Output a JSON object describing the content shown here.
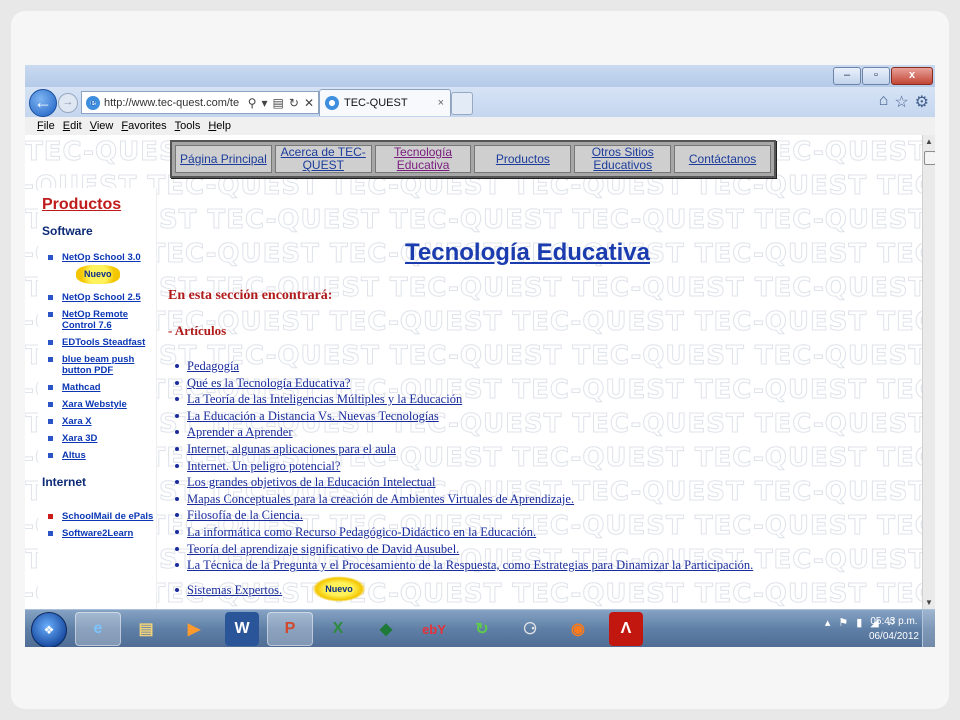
{
  "browser": {
    "address_url": "http://www.tec-quest.com/te",
    "tab_title": "TEC-QUEST",
    "tab_close": "×",
    "menu": [
      "File",
      "Edit",
      "View",
      "Favorites",
      "Tools",
      "Help"
    ],
    "window_buttons": {
      "minimize": "–",
      "maximize": "▫",
      "close": "x"
    }
  },
  "site_nav": [
    {
      "label": "Página Principal"
    },
    {
      "label": "Acerca de TEC-QUEST"
    },
    {
      "label": "Tecnología Educativa",
      "active": true
    },
    {
      "label": "Productos"
    },
    {
      "label": "Otros Sitios Educativos"
    },
    {
      "label": "Contáctanos"
    }
  ],
  "sidebar": {
    "title": "Productos",
    "software_heading": "Software",
    "software_items": [
      {
        "label": "NetOp School 3.0",
        "badge": "Nuevo"
      },
      {
        "label": "NetOp School 2.5"
      },
      {
        "label": "NetOp Remote Control 7.6"
      },
      {
        "label": "EDTools Steadfast"
      },
      {
        "label": "blue beam push button PDF"
      },
      {
        "label": "Mathcad"
      },
      {
        "label": "Xara Webstyle"
      },
      {
        "label": "Xara X"
      },
      {
        "label": "Xara 3D"
      },
      {
        "label": "Altus"
      }
    ],
    "internet_heading": "Internet",
    "internet_items": [
      {
        "label": "SchoolMail de ePals"
      },
      {
        "label": "Software2Learn"
      }
    ]
  },
  "main": {
    "title": "Tecnología Educativa",
    "lead": "En esta sección encontrará:",
    "subheading": "- Artículos",
    "articles": [
      "Pedagogía",
      "Qué es la Tecnología Educativa?",
      "La Teoría de las Inteligencias Múltiples y la Educación",
      "La Educación a Distancia Vs. Nuevas Tecnologías",
      "Aprender a Aprender",
      "Internet, algunas aplicaciones para el aula",
      "Internet. Un peligro potencial?",
      "Los grandes objetivos de la Educación Intelectual",
      "Mapas Conceptuales para la creación de Ambientes Virtuales de Aprendizaje.",
      "Filosofía de la Ciencia.",
      "La informática como Recurso Pedagógico-Didáctico en la Educación.",
      "Teoría del aprendizaje significativo de David Ausubel.",
      "La Técnica de la Pregunta y el Procesamiento de la Respuesta, como Estrategias para Dinamizar la Participación.",
      "Sistemas Expertos."
    ],
    "new_badge": "Nuevo",
    "watermark": "TEC-QUEST"
  },
  "taskbar": {
    "apps": [
      "internet-explorer-icon",
      "file-explorer-icon",
      "media-player-icon",
      "word-icon",
      "powerpoint-icon",
      "excel-icon",
      "publisher-icon",
      "ebay-icon",
      "sync-icon",
      "gadget-icon",
      "firefox-icon",
      "acrobat-icon"
    ],
    "time": "05:43 p.m.",
    "date": "06/04/2012"
  }
}
